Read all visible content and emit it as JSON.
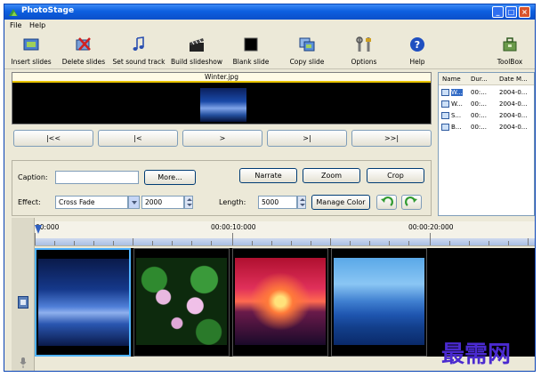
{
  "window": {
    "title": "PhotoStage"
  },
  "menu": {
    "file": "File",
    "help": "Help"
  },
  "toolbar": {
    "insert": "Insert slides",
    "delete": "Delete slides",
    "sound": "Set sound track",
    "build": "Build slideshow",
    "blank": "Blank slide",
    "copy": "Copy slide",
    "options": "Options",
    "help": "Help",
    "toolbox": "ToolBox"
  },
  "preview": {
    "filename": "Winter.jpg"
  },
  "nav": {
    "first": "|<<",
    "prev": "|<",
    "play": ">",
    "next": ">|",
    "last": ">>|"
  },
  "settings": {
    "caption_label": "Caption:",
    "caption_value": "",
    "more": "More...",
    "narrate": "Narrate",
    "zoom": "Zoom",
    "crop": "Crop",
    "effect_label": "Effect:",
    "effect_value": "Cross Fade",
    "effect_duration": "2000",
    "length_label": "Length:",
    "length_value": "5000",
    "manage_color": "Manage Color"
  },
  "filelist": {
    "headers": {
      "name": "Name",
      "duration": "Dur...",
      "date": "Date M..."
    },
    "rows": [
      {
        "name": "W...",
        "duration": "00:...",
        "date": "2004-0..."
      },
      {
        "name": "W...",
        "duration": "00:...",
        "date": "2004-0..."
      },
      {
        "name": "S...",
        "duration": "00:...",
        "date": "2004-0..."
      },
      {
        "name": "B...",
        "duration": "00:...",
        "date": "2004-0..."
      }
    ]
  },
  "timeline": {
    "t0": "00:000",
    "t1": "00:00:10:000",
    "t2": "00:00:20:000"
  },
  "watermark": "最需网",
  "colors": {
    "titlebar": "#0d5fe0",
    "selection": "#316ac5",
    "highlight": "#4fb3ff"
  }
}
